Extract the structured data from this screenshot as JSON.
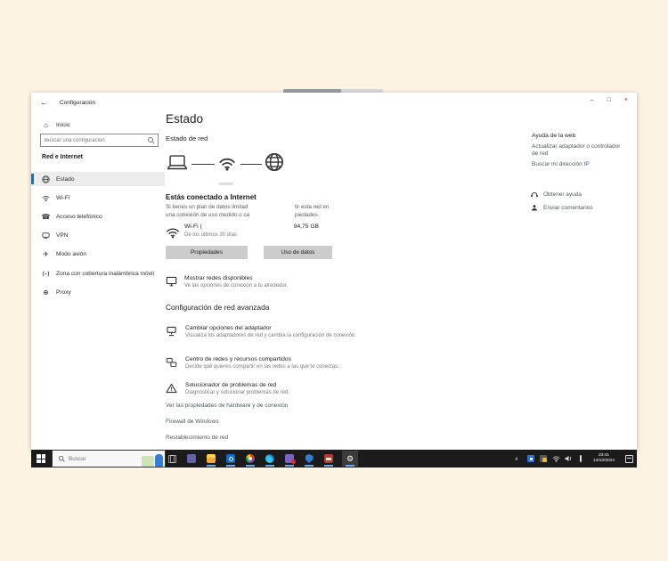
{
  "window": {
    "title": "Configuración"
  },
  "icons": {
    "back": "←",
    "minimize": "–",
    "maximize": "□",
    "close": "×",
    "home": "⌂",
    "phone": "☎",
    "airplane": "✈",
    "proxy": "⊕",
    "gear": "⚙",
    "chevron_up": "∧"
  },
  "sidebar": {
    "home_label": "Inicio",
    "search_placeholder": "Buscar una configuración",
    "section_label": "Red e Internet",
    "items": [
      {
        "label": "Estado",
        "selected": true
      },
      {
        "label": "Wi-Fi"
      },
      {
        "label": "Acceso telefónico"
      },
      {
        "label": "VPN"
      },
      {
        "label": "Modo avión"
      },
      {
        "label": "Zona con cobertura inalámbrica móvil"
      },
      {
        "label": "Proxy"
      }
    ]
  },
  "main": {
    "page_title": "Estado",
    "network_status_header": "Estado de red",
    "connection": {
      "headline": "Estás conectado a Internet",
      "description_left_line1": "Si tienes un plan de datos limitad",
      "description_left_line2": "una conexión de uso medido o ca",
      "description_right_line1": "tir esta red en",
      "description_right_line2": "piedades.",
      "network_name": "Wi-Fi (",
      "usage_period": "De los últimos 30 días",
      "data_used": "94,75 GB",
      "properties_button": "Propiedades",
      "data_usage_button": "Uso de datos"
    },
    "show_networks": {
      "title": "Mostrar redes disponibles",
      "subtitle": "Ve las opciones de conexión a tu alrededor."
    },
    "advanced_header": "Configuración de red avanzada",
    "advanced_items": [
      {
        "title": "Cambiar opciones del adaptador",
        "description": "Visualiza los adaptadores de red y cambia la configuración de conexión."
      },
      {
        "title": "Centro de redes y recursos compartidos",
        "description": "Decide qué quieres compartir en las redes a las que te conectas."
      },
      {
        "title": "Solucionador de problemas de red",
        "description": "Diagnosticar y solucionar problemas de red."
      }
    ],
    "links": [
      "Ver las propiedades de hardware y de conexión",
      "Firewall de Windows",
      "Restablecimiento de red"
    ]
  },
  "help_panel": {
    "header": "Ayuda de la web",
    "links": [
      "Actualizar adaptador o controlador de red",
      "Buscar mi dirección IP"
    ],
    "get_help_label": "Obtener ayuda",
    "feedback_label": "Enviar comentarios"
  },
  "taskbar": {
    "search_placeholder": "Buscar",
    "clock_time": "23:41",
    "clock_date": "14/10/2024"
  },
  "colors": {
    "accent": "#0078d7",
    "desktop_background": "#fdf3e3",
    "taskbar": "#1b1b1b",
    "link": "#4e585e"
  }
}
